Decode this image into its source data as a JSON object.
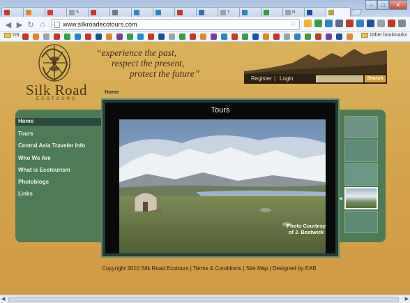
{
  "browser": {
    "tabs": [
      {
        "title": "",
        "color": "#c63b2c"
      },
      {
        "title": "",
        "color": "#e0892a"
      },
      {
        "title": "",
        "color": "#d9363e"
      },
      {
        "title": "S",
        "color": "#9aa2ac"
      },
      {
        "title": "",
        "color": "#c0392b"
      },
      {
        "title": "",
        "color": "#6d7a86"
      },
      {
        "title": "",
        "color": "#2e86c1"
      },
      {
        "title": "",
        "color": "#2e86c1"
      },
      {
        "title": "",
        "color": "#c0392b"
      },
      {
        "title": "",
        "color": "#3d6fb3"
      },
      {
        "title": "T",
        "color": "#9aa2ac"
      },
      {
        "title": "",
        "color": "#2e86c1"
      },
      {
        "title": "",
        "color": "#3a9c45"
      },
      {
        "title": "N",
        "color": "#9aa2ac"
      },
      {
        "title": "",
        "color": "#1f4f9e"
      },
      {
        "title": "",
        "color": "#b8a24a"
      }
    ],
    "url": "www.silkroadecotours.com",
    "bookmarks_folder": "DS",
    "other_bookmarks": "Other bookmarks"
  },
  "header": {
    "logo_title": "Silk Road",
    "logo_sub": "ECOTOURS",
    "tagline": [
      "“experience the past,",
      "respect the present,",
      "protect the future”"
    ],
    "register": "Register",
    "sep": "|",
    "login": "Login",
    "search_button": "Search"
  },
  "breadcrumb": "Home",
  "nav": [
    "Home",
    "Tours",
    "Central Asia Traveler Info",
    "Who We Are",
    "What is Ecotourism",
    "Photoblogs",
    "Links"
  ],
  "stage": {
    "title": "Tours",
    "credit_line1": "Photo Courtesy",
    "credit_line2": "of J. Bostwick"
  },
  "footer": {
    "copyright": "Copyright 2010 Silk Road Ecotours",
    "terms": "Terms & Conditions",
    "sitemap": "Site Map",
    "designed": "Designed by EAB",
    "sep": " | "
  },
  "colors": {
    "page_gold": "#d4a54e",
    "panel_green": "#4c7b55",
    "nav_active": "#2a4a3f",
    "search_orange": "#d59a2f"
  }
}
